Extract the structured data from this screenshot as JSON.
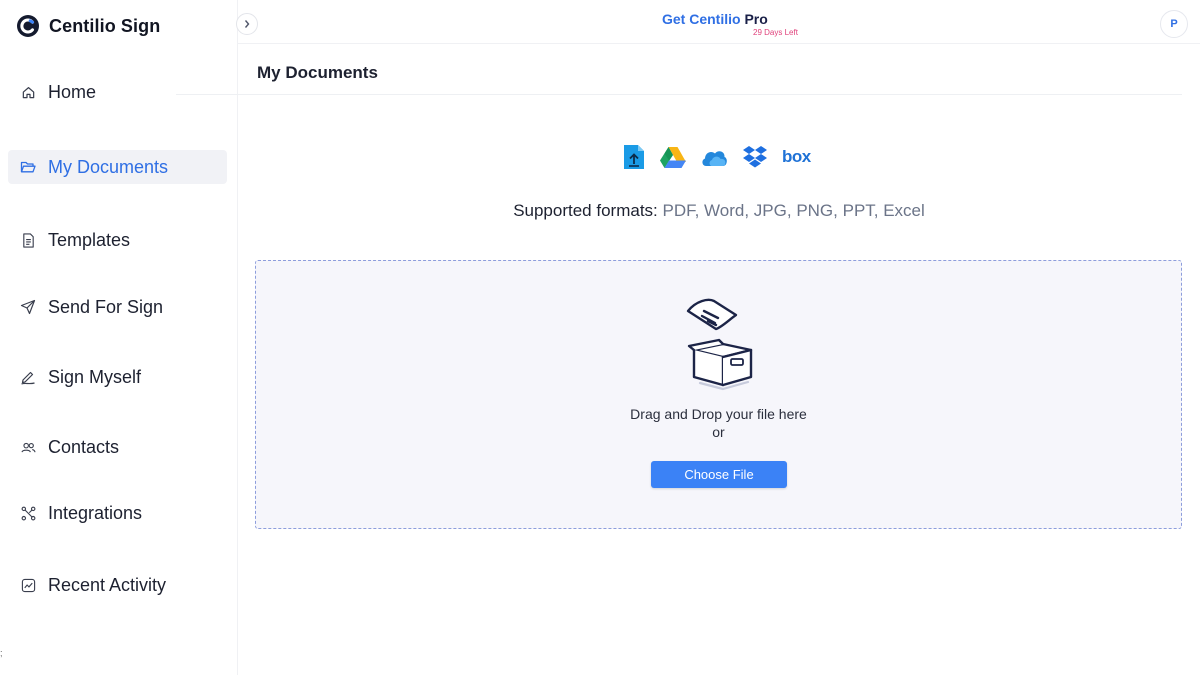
{
  "brand": {
    "name": "Centilio Sign",
    "accent": "#2f6fe4"
  },
  "sidebar": {
    "items": [
      {
        "label": "Home",
        "icon": "home-icon",
        "active": false
      },
      {
        "label": "My Documents",
        "icon": "folder-open-icon",
        "active": true
      },
      {
        "label": "Templates",
        "icon": "document-icon",
        "active": false
      },
      {
        "label": "Send For Sign",
        "icon": "send-icon",
        "active": false
      },
      {
        "label": "Sign Myself",
        "icon": "pen-icon",
        "active": false
      },
      {
        "label": "Contacts",
        "icon": "users-icon",
        "active": false
      },
      {
        "label": "Integrations",
        "icon": "integrations-icon",
        "active": false
      },
      {
        "label": "Recent Activity",
        "icon": "activity-chart-icon",
        "active": false
      }
    ]
  },
  "topbar": {
    "promo_prefix": "Get Centilio",
    "promo_suffix": " Pro",
    "promo_sub": "29 Days Left",
    "avatar_initial": "P"
  },
  "main": {
    "title": "My Documents",
    "sources": [
      "upload-icon",
      "google-drive-icon",
      "onedrive-icon",
      "dropbox-icon",
      "box-icon"
    ],
    "box_label": "box",
    "formats_label": "Supported formats:",
    "formats_value": " PDF, Word, JPG, PNG, PPT, Excel",
    "drop_text": "Drag and Drop your file here",
    "drop_or": "or",
    "choose_button": "Choose File"
  },
  "stray_char": ";"
}
